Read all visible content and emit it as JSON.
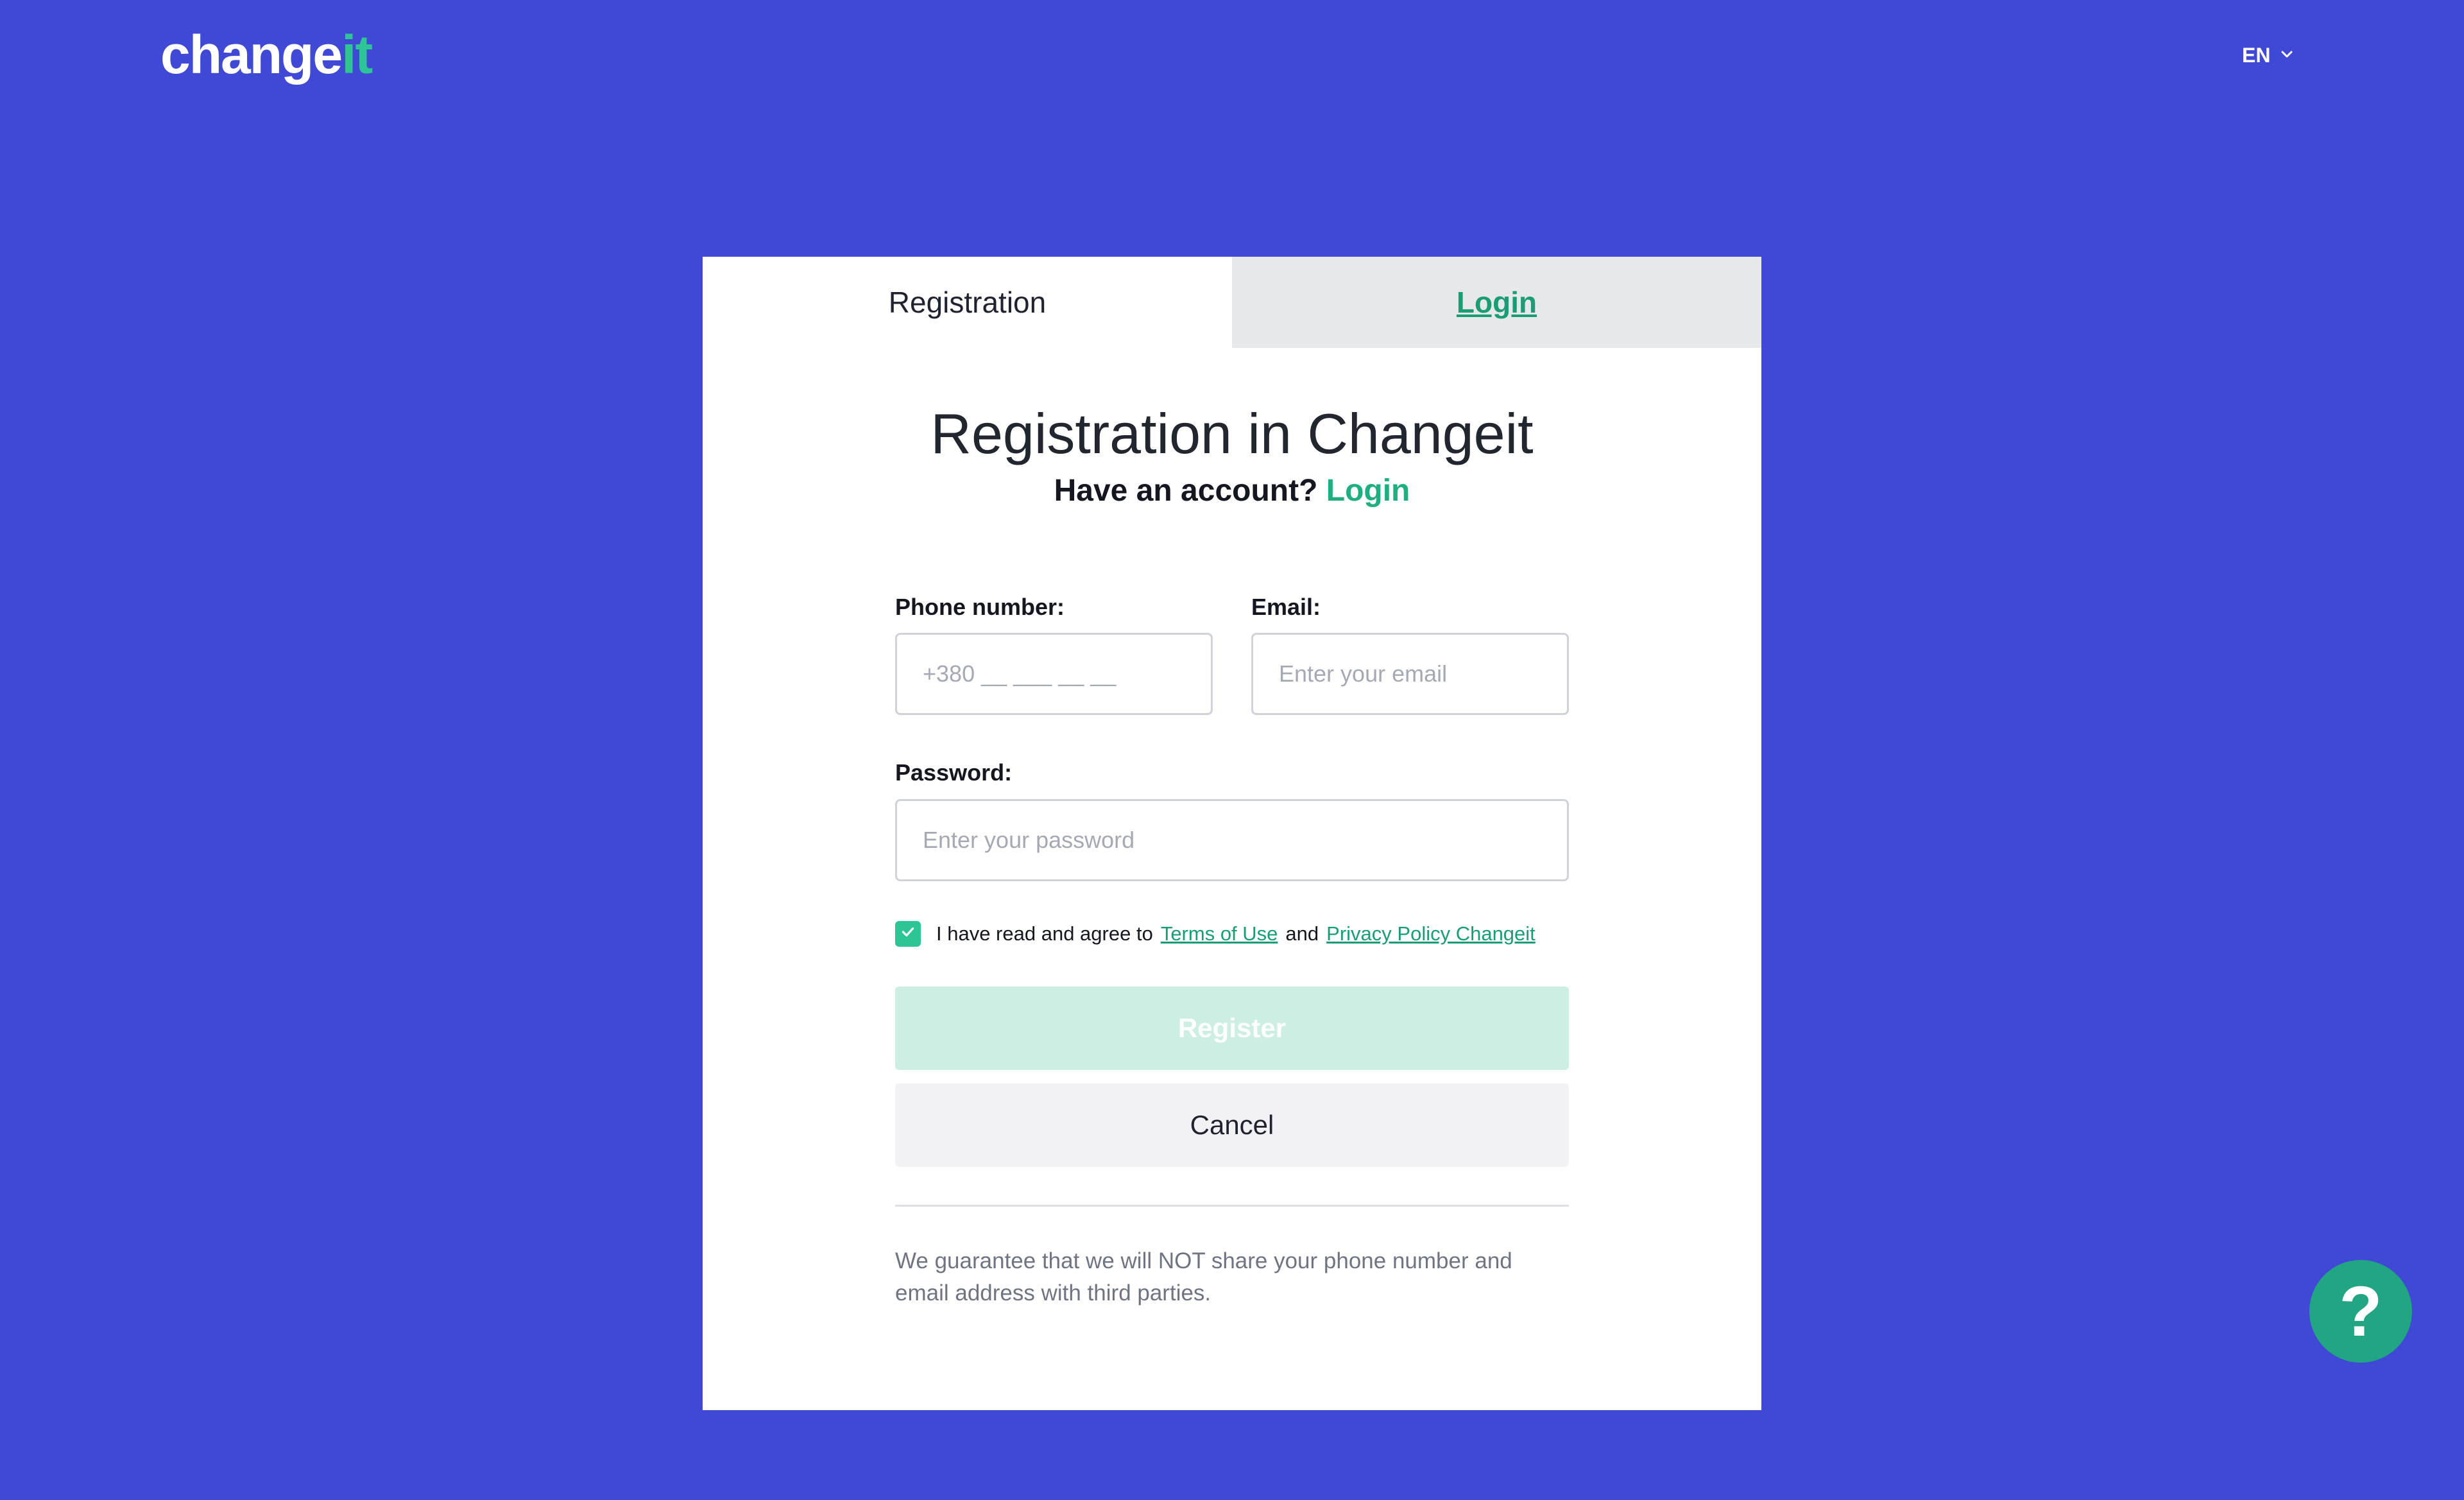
{
  "header": {
    "logo_main": "change",
    "logo_accent": "it",
    "language": "EN"
  },
  "tabs": [
    {
      "label": "Registration",
      "active": true
    },
    {
      "label": "Login",
      "active": false
    }
  ],
  "form": {
    "title": "Registration in Changeit",
    "subtitle_prefix": "Have an account?",
    "subtitle_link": "Login",
    "phone_label": "Phone number:",
    "phone_placeholder": "+380 __ ___ __ __",
    "email_label": "Email:",
    "email_placeholder": "Enter your email",
    "password_label": "Password:",
    "password_placeholder": "Enter your password",
    "agree_checked": true,
    "agree_text": "I have read and agree to",
    "terms_link": "Terms of Use",
    "agree_and": "and",
    "privacy_link": "Privacy Policy Changeit",
    "register_label": "Register",
    "cancel_label": "Cancel",
    "note": "We guarantee that we will NOT share your phone number and email address with third parties."
  },
  "help": {
    "label": "?"
  },
  "colors": {
    "background": "#4048d6",
    "accent": "#2dc596",
    "link": "#1a9d75",
    "register_disabled": "#cdeee2"
  },
  "icons": [
    "chevron-down-icon",
    "check-icon",
    "help-icon"
  ]
}
